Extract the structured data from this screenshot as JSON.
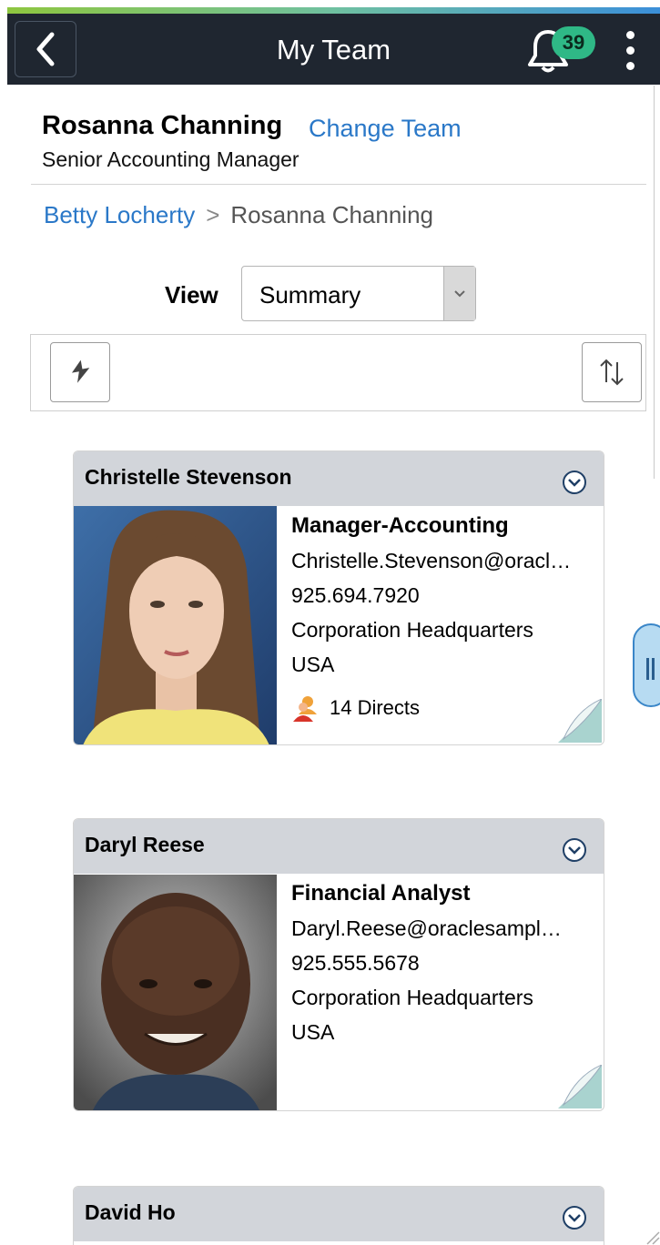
{
  "header": {
    "title": "My Team",
    "notification_count": "39"
  },
  "manager": {
    "name": "Rosanna Channing",
    "change_team_label": "Change Team",
    "job_title": "Senior Accounting Manager"
  },
  "breadcrumb": {
    "items": [
      "Betty Locherty",
      "Rosanna Channing"
    ],
    "separator": ">"
  },
  "view": {
    "label": "View",
    "selected": "Summary"
  },
  "employees": [
    {
      "name": "Christelle Stevenson",
      "job_title": "Manager-Accounting",
      "email": "Christelle.Stevenson@oracl…",
      "phone": "925.694.7920",
      "location": "Corporation Headquarters",
      "country": "USA",
      "directs": "14 Directs"
    },
    {
      "name": "Daryl Reese",
      "job_title": "Financial Analyst",
      "email": "Daryl.Reese@oraclesampl…",
      "phone": "925.555.5678",
      "location": "Corporation Headquarters",
      "country": "USA"
    },
    {
      "name": "David Ho"
    }
  ],
  "colors": {
    "header_bg": "#1f2630",
    "link": "#2a78c8",
    "badge": "#2fb886",
    "card_header": "#d2d5da"
  },
  "icons": [
    "chevron-left-icon",
    "bell-icon",
    "kebab-menu-icon",
    "dropdown-chevron-icon",
    "hierarchy-icon",
    "sort-icon",
    "expand-chevron-icon",
    "directs-icon",
    "page-fold-icon"
  ]
}
